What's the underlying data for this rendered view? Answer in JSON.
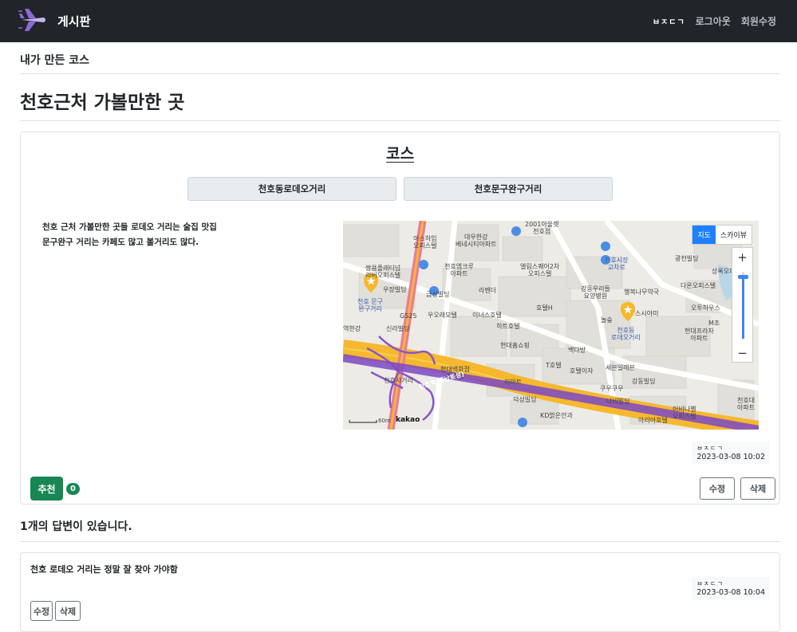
{
  "navbar": {
    "brand": "게시판",
    "user": "ㅂㅈㄷㄱ",
    "logout": "로그아웃",
    "edit_profile": "회원수정"
  },
  "section_heading": "내가 만든 코스",
  "post": {
    "title": "천호근처 가볼만한 곳",
    "course_heading": "코스",
    "tabs": [
      {
        "label": "천호동로데오거리"
      },
      {
        "label": "천호문구완구거리"
      }
    ],
    "description": [
      "천호 근처 가볼만한 곳들 로데오 거리는 술집 맛집",
      "문구완구 거리는 카페도 많고 볼거리도 많다."
    ],
    "map": {
      "type_active": "지도",
      "type_other": "스카이뷰",
      "zoom_in": "+",
      "zoom_out": "−",
      "scale_label": "60m",
      "logo": "kakao",
      "markers": [
        {
          "name": "천호 문구 완구거리",
          "line1": "천호 문구",
          "line2": "완구거리"
        },
        {
          "name": "천호동 로데오거리",
          "line1": "천호동",
          "line2": "로데오거리"
        }
      ],
      "labels": {
        "a1": "2001아울렛",
        "a2": "천호점",
        "b1": "아스하임",
        "b2": "오피스텔",
        "c1": "대우한강",
        "c2": "베네시티아파트",
        "d1": "쌍용플래티넘",
        "d2": "리버오피스텔",
        "e1": "천호엠크루",
        "e2": "아파트",
        "f1": "엘림스퀘어2차",
        "f2": "오피스텔",
        "g": "광천빌딩",
        "h": "상록오피",
        "i": "우장빌딩",
        "j": "금성빌딩",
        "k": "라벤더",
        "l1": "강동우리들",
        "l2": "요양병원",
        "m": "행복나무약국",
        "n": "다온오피스텔",
        "o": "GS25",
        "p": "우오래모텔",
        "q": "이너스호텔",
        "r": "호텔H",
        "s": "오투하우스",
        "t": "스시야미",
        "u": "신라빌딩",
        "v": "히트호텔",
        "w": "M조",
        "x1": "현대프라자",
        "x2": "아파트",
        "y": "현대홈쇼핑",
        "z": "백다방",
        "aa1": "현대백화점",
        "aa2": "천호점",
        "bb": "T호텔",
        "cc": "호텔이자",
        "dd": "세븐일레븐",
        "ee": "강동빌딩",
        "ff": "이마트",
        "gg": "쿠우쿠우",
        "hh": "나비빌딩",
        "ii": "덕성빌딩",
        "jj": "KD밝은안과",
        "kk1": "어비나벨",
        "kk2": "오피스텔",
        "ll": "아리아호텔",
        "mm1": "천호대",
        "mm2": "아파트",
        "nn1": "천호시장",
        "nn2": "교차로",
        "oo": "천호역(풍납토성)",
        "pp": "역한강",
        "qq": "천호사거리",
        "rr": "놀숲",
        "ss": "하이힐"
      }
    },
    "meta": {
      "author": "ㅂㅈㄷㄱ",
      "date": "2023-03-08 10:02"
    },
    "recommend_label": "추천",
    "recommend_count": "0",
    "edit_label": "수정",
    "delete_label": "삭제"
  },
  "answers": {
    "heading": "1개의 답변이 있습니다.",
    "items": [
      {
        "content": "천호 로데오 거리는 정말 잘 찾아 가야함",
        "author": "ㅂㅈㄷㄱ",
        "date": "2023-03-08 10:04",
        "edit_label": "수정",
        "delete_label": "삭제"
      }
    ]
  },
  "colors": {
    "navbar_bg": "#212529",
    "primary_green": "#198754",
    "road_orange": "#f5b82e",
    "subway_purple": "#8a55c8",
    "road_pink": "#ea7a9c",
    "map_bg": "#ecebe6"
  },
  "icons": [
    "airplane-logo-icon",
    "star-marker-icon",
    "bus-stop-icon",
    "zoom-in-icon",
    "zoom-out-icon"
  ]
}
